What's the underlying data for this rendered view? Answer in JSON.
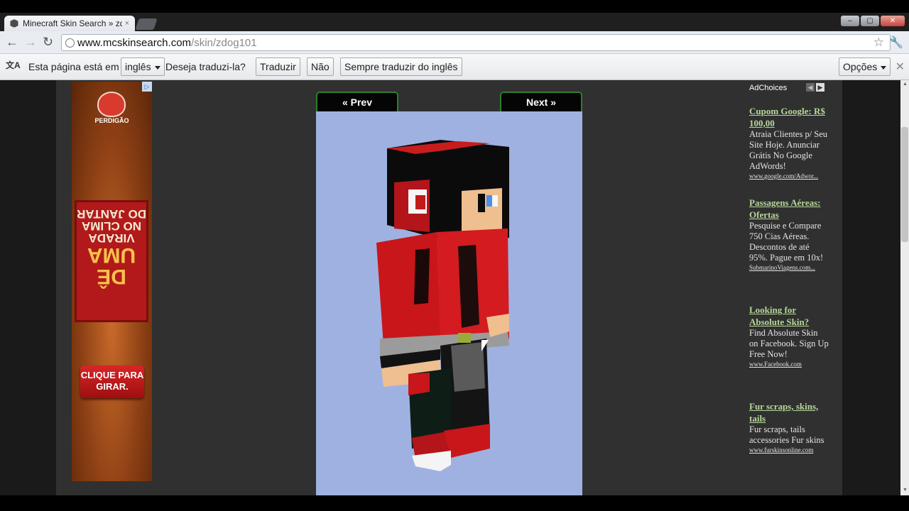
{
  "browser": {
    "tab_title": "Minecraft Skin Search » zdo",
    "tab_close": "×",
    "url_host": "www.mcskinsearch.com",
    "url_path": "/skin/zdog101",
    "window_controls": [
      "‒",
      "▢",
      "✕"
    ]
  },
  "translate_bar": {
    "prefix": "Esta página está em",
    "language": "inglês",
    "question": "Deseja traduzi-la?",
    "translate_label": "Traduzir",
    "no_label": "Não",
    "always_label": "Sempre traduzir do inglês",
    "options_label": "Opções"
  },
  "left_ad": {
    "brand": "PERDIGÃO",
    "line1": "DÊ",
    "line2": "UMA",
    "line3": "VIRADA",
    "line4": "NO CLIMA",
    "line5": "DO JANTAR",
    "cta": "CLIQUE PARA GIRAR."
  },
  "viewer": {
    "prev_label": "« Prev",
    "next_label": "Next »"
  },
  "right_ads": {
    "adchoices": "AdChoices",
    "ads": [
      {
        "title": "Cupom Google: R$ 100,00",
        "desc": "Atraia Clientes p/ Seu Site Hoje. Anunciar Grátis No Google AdWords!",
        "url": "www.google.com/Adwor..."
      },
      {
        "title": "Passagens Aéreas: Ofertas",
        "desc": "Pesquise e Compare 750 Cias Aéreas. Descontos de até 95%. Pague em 10x!",
        "url": "SubmarinoViagens.com..."
      },
      {
        "title": "Looking for Absolute Skin?",
        "desc": "Find Absolute Skin on Facebook. Sign Up Free Now!",
        "url": "www.Facebook.com"
      },
      {
        "title": "Fur scraps, skins, tails",
        "desc": "Fur scraps, tails accessories Fur skins",
        "url": "www.furskinsonline.com"
      }
    ]
  },
  "colors": {
    "page_bg": "#303030",
    "stage_bg": "#9fb1e0",
    "ad_link": "#b6d798",
    "nav_border": "#2f7d2f"
  }
}
